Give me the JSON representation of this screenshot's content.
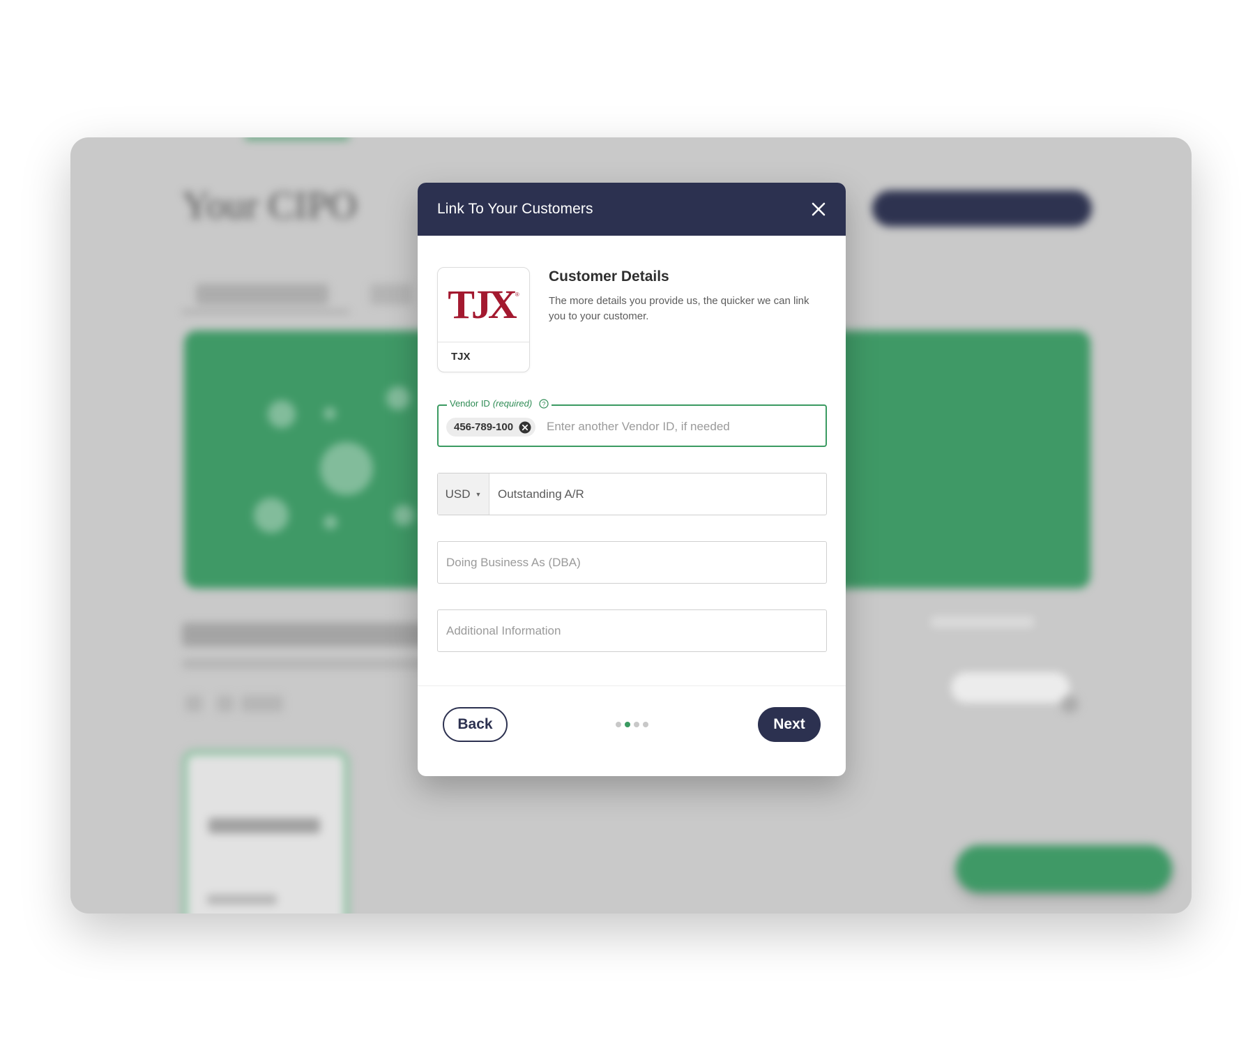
{
  "modal": {
    "title": "Link To Your Customers",
    "close_icon": "close-icon"
  },
  "customer": {
    "logo_text": "TJX",
    "logo_color": "#a3192f",
    "name": "TJX",
    "section_title": "Customer Details",
    "section_description": "The more details you provide us, the quicker we can link you to your customer."
  },
  "vendor_field": {
    "label": "Vendor ID",
    "required_label": "(required)",
    "help_icon": "help-circle-icon",
    "chip_value": "456-789-100",
    "chip_remove_icon": "remove-circle-icon",
    "placeholder": "Enter another Vendor ID, if needed"
  },
  "ar_field": {
    "currency": "USD",
    "placeholder": "Outstanding A/R"
  },
  "dba_field": {
    "placeholder": "Doing Business As (DBA)"
  },
  "info_field": {
    "placeholder": "Additional Information"
  },
  "footer": {
    "back_label": "Back",
    "next_label": "Next",
    "steps_total": 4,
    "current_step": 2
  },
  "colors": {
    "header_bg": "#2c3150",
    "accent_green": "#3a9a61",
    "brand_red": "#a3192f"
  }
}
